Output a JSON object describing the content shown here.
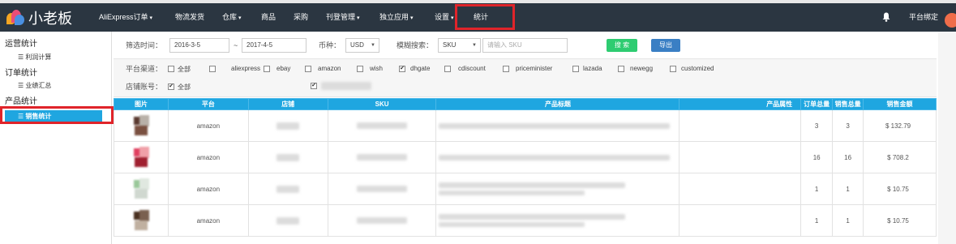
{
  "app": {
    "logo_text": "小老板"
  },
  "nav": {
    "items": [
      {
        "label": "AliExpress订单",
        "caret": "▾"
      },
      {
        "label": "物流发货",
        "caret": ""
      },
      {
        "label": "仓库",
        "caret": "▾"
      },
      {
        "label": "商品",
        "caret": ""
      },
      {
        "label": "采购",
        "caret": ""
      },
      {
        "label": "刊登管理",
        "caret": "▾"
      },
      {
        "label": "独立应用",
        "caret": "▾"
      },
      {
        "label": "设置",
        "caret": "▾"
      },
      {
        "label": "统计",
        "caret": ""
      }
    ],
    "right_text": "平台绑定",
    "highlight_color": "#e0242a"
  },
  "sidebar": {
    "sections": [
      {
        "title": "运营统计",
        "items": [
          "☰ 利润计算"
        ]
      },
      {
        "title": "订单统计",
        "items": [
          "☰ 业绩汇总"
        ]
      },
      {
        "title": "产品统计",
        "items": [
          "☰ 销售统计"
        ]
      }
    ],
    "active_item": "☰ 销售统计",
    "accent_color": "#1fa6e0"
  },
  "filters": {
    "date_label": "筛选时间：",
    "date_from": "2016-3-5",
    "date_sep": "~",
    "date_to": "2017-4-5",
    "currency_label": "币种：",
    "currency_value": "USD",
    "fuzzy_label": "模糊搜索：",
    "fuzzy_field": "SKU",
    "search_placeholder": "请输入 SKU",
    "search_button": "搜 索",
    "export_button": "导出"
  },
  "channels": {
    "label": "平台渠道：",
    "options": [
      {
        "name": "全部",
        "checked": false
      },
      {
        "name": "aliexpress",
        "checked": false
      },
      {
        "name": "ebay",
        "checked": false
      },
      {
        "name": "amazon",
        "checked": false
      },
      {
        "name": "wish",
        "checked": false
      },
      {
        "name": "dhgate",
        "checked": true
      },
      {
        "name": "cdiscount",
        "checked": false
      },
      {
        "name": "priceminister",
        "checked": false
      },
      {
        "name": "lazada",
        "checked": false
      },
      {
        "name": "newegg",
        "checked": false
      },
      {
        "name": "customized",
        "checked": false
      }
    ],
    "shop_label": "店铺账号：",
    "shop_all": "全部"
  },
  "table": {
    "headers": [
      "图片",
      "平台",
      "店铺",
      "SKU",
      "产品标题",
      "产品属性",
      "订单总量",
      "销售总量",
      "销售金额"
    ],
    "rows": [
      {
        "platform": "amazon",
        "orders": "3",
        "sales": "3",
        "amount": "$ 132.79"
      },
      {
        "platform": "amazon",
        "orders": "16",
        "sales": "16",
        "amount": "$ 708.2"
      },
      {
        "platform": "amazon",
        "orders": "1",
        "sales": "1",
        "amount": "$ 10.75"
      },
      {
        "platform": "amazon",
        "orders": "1",
        "sales": "1",
        "amount": "$ 10.75"
      }
    ]
  }
}
